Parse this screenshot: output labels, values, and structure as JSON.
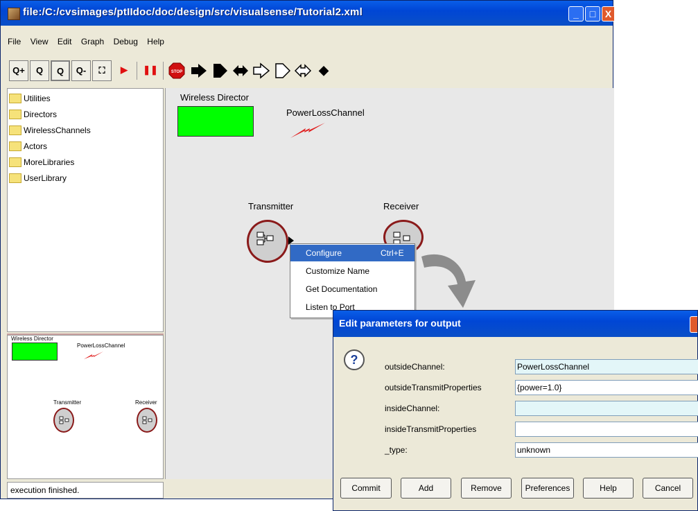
{
  "window": {
    "title": "file:/C:/cvsimages/ptIIdoc/doc/design/src/visualsense/Tutorial2.xml",
    "controls": [
      "_",
      "□",
      "X"
    ]
  },
  "menu": [
    "File",
    "View",
    "Edit",
    "Graph",
    "Debug",
    "Help"
  ],
  "toolbar": {
    "zoom_in": "Q+",
    "zoom_reset": "Q",
    "zoom_fit": "Q",
    "zoom_out": "Q-",
    "fullscreen": "⛶",
    "run": "▶",
    "pause": "❚❚",
    "stop": "STOP",
    "port_labels": [
      "◆"
    ]
  },
  "library": {
    "items": [
      "Utilities",
      "Directors",
      "WirelessChannels",
      "Actors",
      "MoreLibraries",
      "UserLibrary"
    ]
  },
  "overview": {
    "director_label": "Wireless Director",
    "channel_label": "PowerLossChannel",
    "transmitter_label": "Transmitter",
    "receiver_label": "Receiver"
  },
  "status": {
    "text": "execution finished."
  },
  "canvas": {
    "director_label": "Wireless Director",
    "channel_label": "PowerLossChannel",
    "transmitter_label": "Transmitter",
    "receiver_label": "Receiver",
    "colors": {
      "director": "#00ff00",
      "actor_ring": "#8a1a1a",
      "channel_bolt": "#e02020"
    }
  },
  "context_menu": {
    "items": [
      {
        "label": "Configure",
        "shortcut": "Ctrl+E"
      },
      {
        "label": "Customize Name",
        "shortcut": ""
      },
      {
        "label": "Get Documentation",
        "shortcut": ""
      },
      {
        "label": "Listen to Port",
        "shortcut": ""
      }
    ]
  },
  "dialog": {
    "title": "Edit parameters for output",
    "params": [
      {
        "name": "outsideChannel:",
        "value": "PowerLossChannel"
      },
      {
        "name": "outsideTransmitProperties",
        "value": "{power=1.0}"
      },
      {
        "name": "insideChannel:",
        "value": ""
      },
      {
        "name": "insideTransmitProperties",
        "value": ""
      },
      {
        "name": "_type:",
        "value": "unknown"
      }
    ],
    "buttons": [
      "Commit",
      "Add",
      "Remove",
      "Preferences",
      "Help",
      "Cancel"
    ]
  }
}
